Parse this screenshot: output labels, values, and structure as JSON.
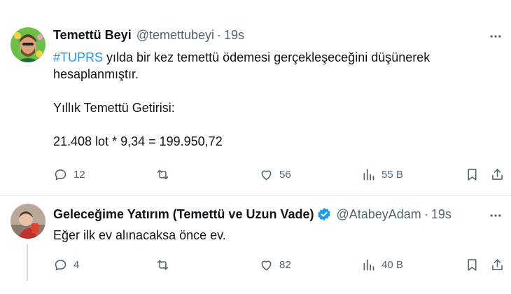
{
  "tweets": [
    {
      "name": "Temettü Beyi",
      "handle": "@temettubeyi",
      "dot": "·",
      "time": "19s",
      "hashtag": "#TUPRS",
      "line1_rest": " yılda bir kez temettü ödemesi gerçekleşeceğini düşünerek",
      "line2": "hesaplanmıştır.",
      "line3": "Yıllık Temettü Getirisi:",
      "line4": "21.408 lot * 9,34 = 199.950,72",
      "replies": "12",
      "likes": "56",
      "views": "55 B"
    },
    {
      "name": "Geleceğime Yatırım (Temettü ve Uzun Vade)",
      "handle": "@AtabeyAdam",
      "dot": "·",
      "time": "19s",
      "text": "Eğer ilk ev alınacaksa önce ev.",
      "replies": "4",
      "likes": "82",
      "views": "40 B"
    }
  ],
  "colors": {
    "accent": "#1d9bf0",
    "muted": "#536471",
    "text": "#0f1419"
  },
  "icons": [
    "more-icon",
    "reply-icon",
    "retweet-icon",
    "like-icon",
    "views-icon",
    "bookmark-icon",
    "share-icon",
    "verified-icon"
  ]
}
